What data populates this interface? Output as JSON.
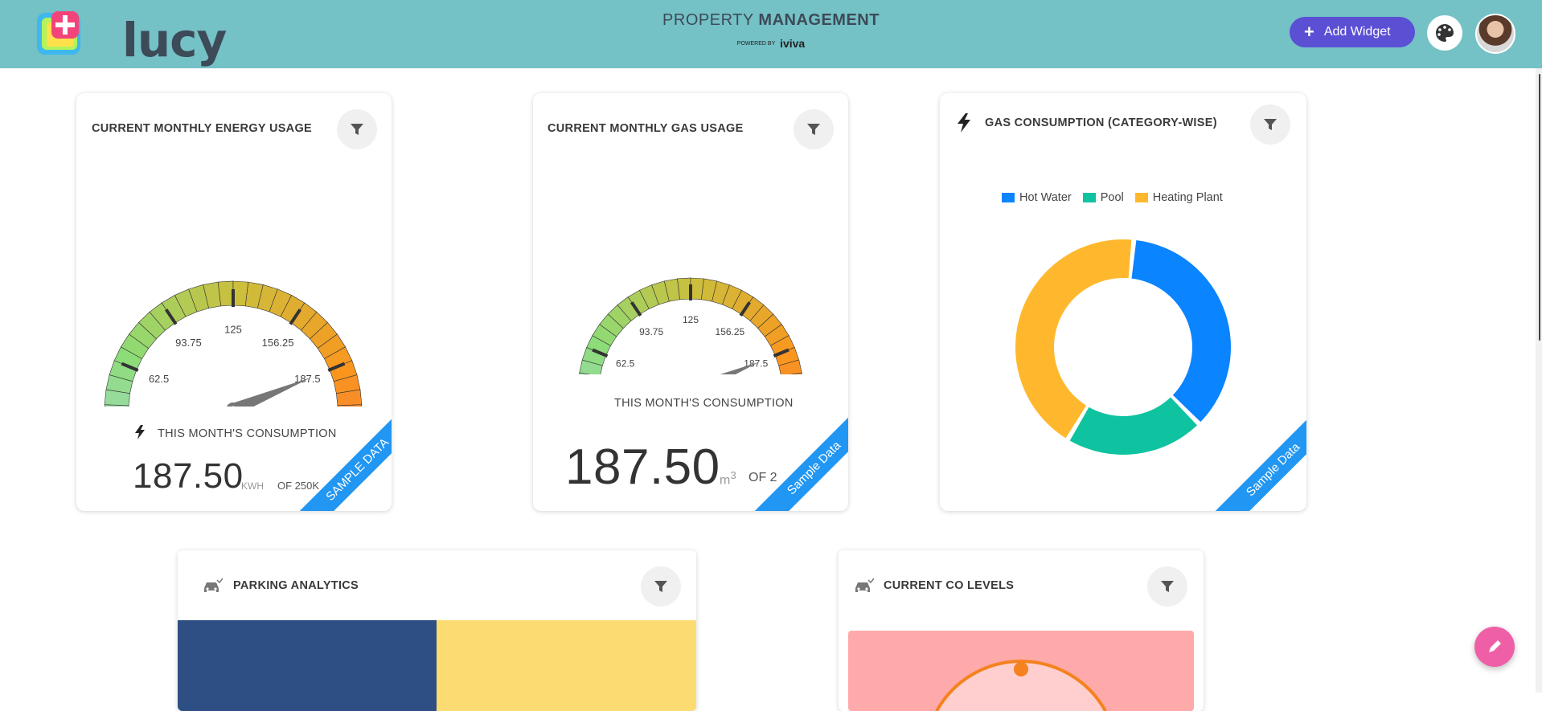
{
  "header": {
    "logo_text": "lucy",
    "title_light": "PROPERTY",
    "title_bold": "MANAGEMENT",
    "powered_by": "POWERED BY",
    "powered_brand": "iviva",
    "add_widget_label": "Add Widget",
    "palette_icon": "palette-icon",
    "avatar_icon": "user-avatar"
  },
  "widgets": {
    "energy": {
      "title": "CURRENT MONTHLY ENERGY USAGE",
      "consumption_label": "THIS MONTH'S CONSUMPTION",
      "value": "187.50",
      "unit": "KWH",
      "of_text": "OF 250K",
      "ribbon": "SAMPLE DATA",
      "gauge": {
        "min": 0,
        "max": 250,
        "value": 187.5,
        "ticks": [
          "0",
          "31.25",
          "62.5",
          "93.75",
          "125",
          "156.25",
          "187.5",
          "218.75",
          "250"
        ]
      }
    },
    "gas": {
      "title": "CURRENT MONTHLY GAS USAGE",
      "consumption_label": "THIS MONTH'S CONSUMPTION",
      "value": "187.50",
      "unit": "m",
      "unit_sup": "3",
      "of_text": "OF 2",
      "ribbon": "Sample Data",
      "gauge": {
        "min": 0,
        "max": 250,
        "value": 187.5,
        "ticks": [
          "0",
          "31.25",
          "62.5",
          "93.75",
          "125",
          "156.25",
          "187.5",
          "218.75",
          "250"
        ]
      }
    },
    "gas_category": {
      "title": "GAS CONSUMPTION (CATEGORY-WISE)",
      "ribbon": "Sample Data",
      "legend": [
        {
          "label": "Hot Water",
          "color": "#0a84ff"
        },
        {
          "label": "Pool",
          "color": "#10c3a0"
        },
        {
          "label": "Heating Plant",
          "color": "#ffb82e"
        }
      ]
    },
    "parking": {
      "title": "PARKING ANALYTICS",
      "colors": [
        "#2e4f84",
        "#fcdc72"
      ]
    },
    "co": {
      "title": "CURRENT CO LEVELS",
      "panel_color": "#ffaaaa"
    }
  },
  "chart_data": [
    {
      "type": "pie",
      "title": "GAS CONSUMPTION (CATEGORY-WISE)",
      "categories": [
        "Hot Water",
        "Pool",
        "Heating Plant"
      ],
      "values": [
        36,
        21,
        43
      ],
      "colors": [
        "#0a84ff",
        "#10c3a0",
        "#ffb82e"
      ],
      "donut": true,
      "legend": "top"
    }
  ],
  "fab_icon": "pencil-icon"
}
